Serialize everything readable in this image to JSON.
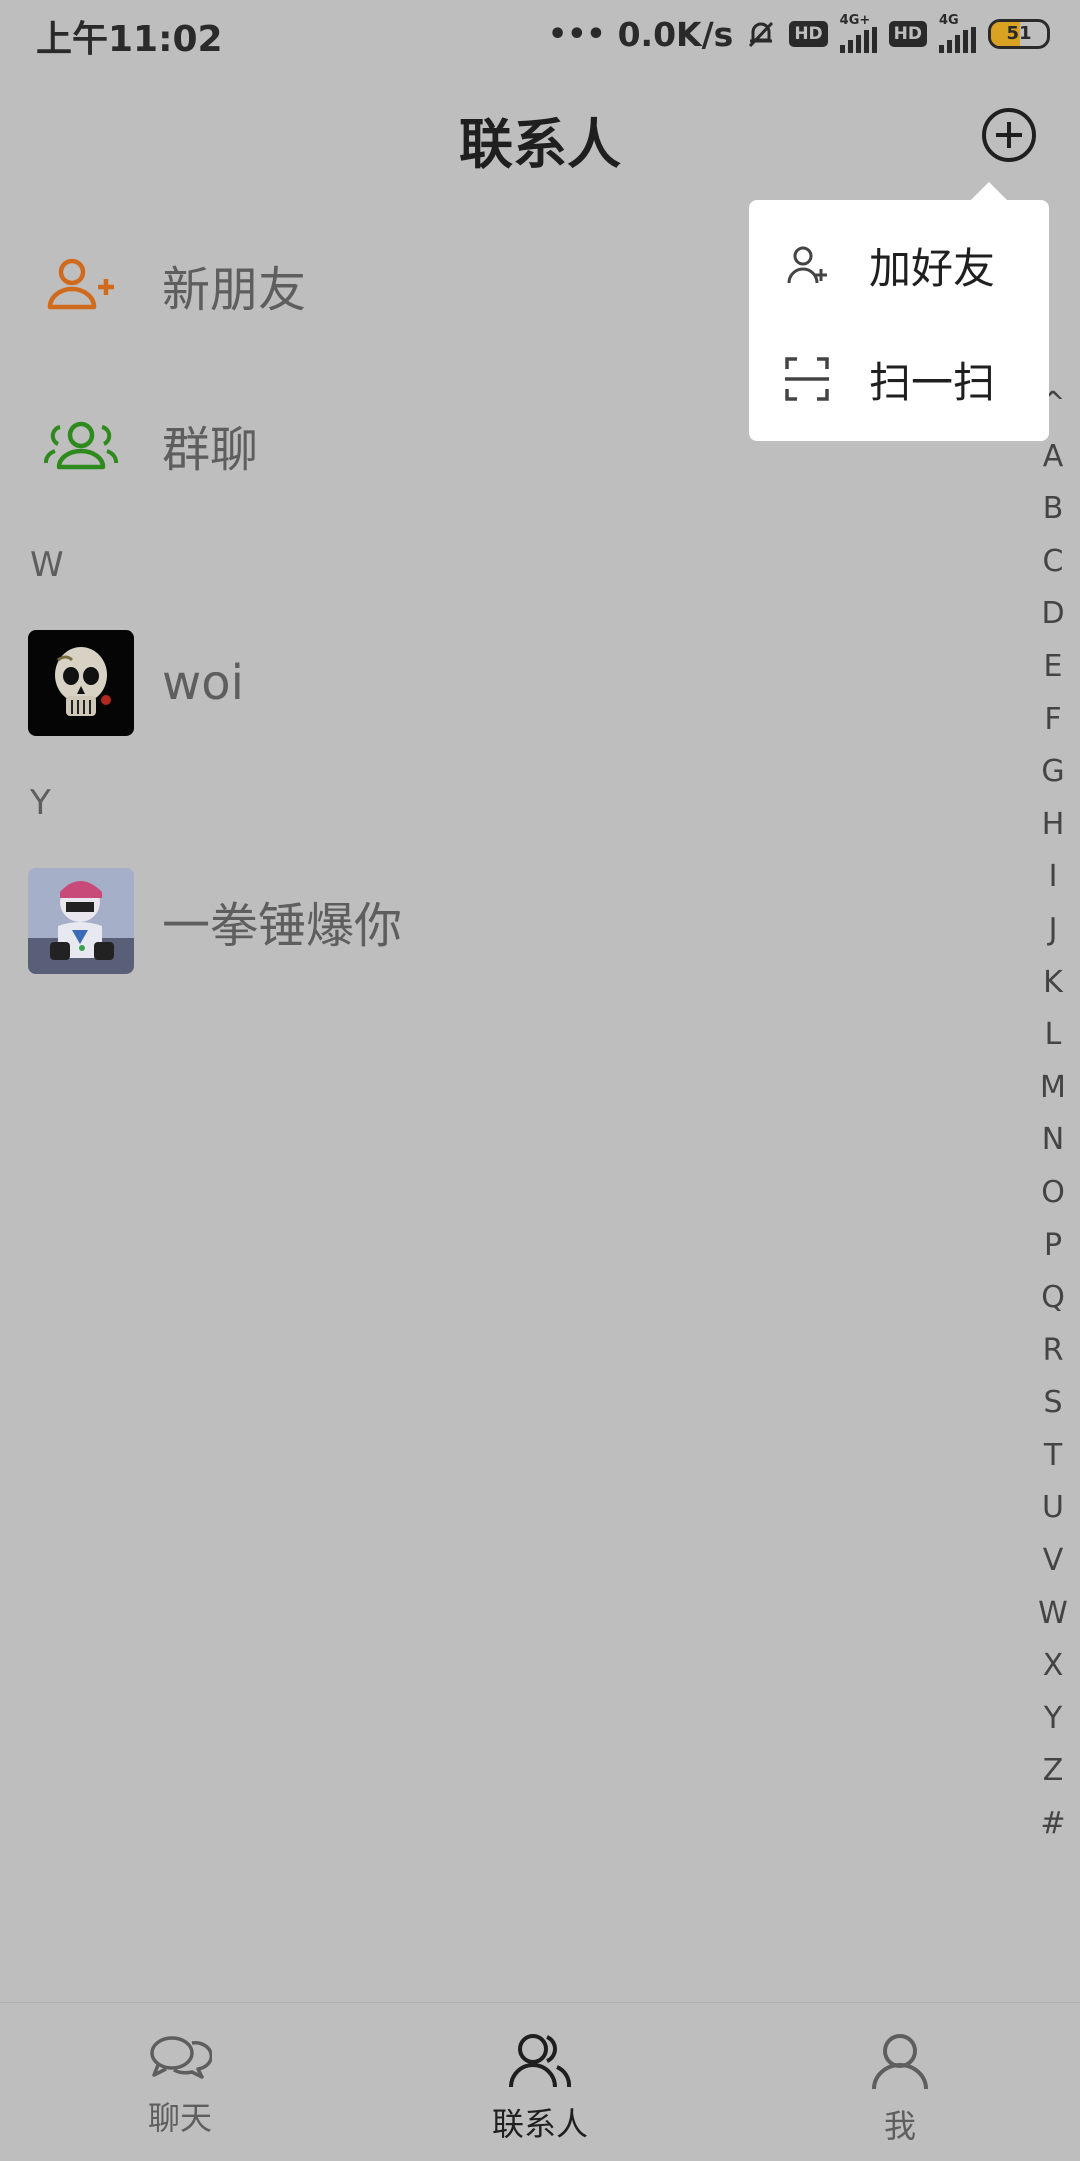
{
  "status_bar": {
    "time": "上午11:02",
    "network_speed": "0.0K/s",
    "hd_badge": "HD",
    "signal1_type": "4G+",
    "signal2_type": "4G",
    "battery_level": "51",
    "battery_fraction": 0.51,
    "battery_color": "#d9a321"
  },
  "header": {
    "title": "联系人",
    "add_icon": "circle-plus-icon"
  },
  "contacts": {
    "fixed": [
      {
        "label": "新朋友",
        "icon": "add-person-icon",
        "color": "#d06a1c"
      },
      {
        "label": "群聊",
        "icon": "group-icon",
        "color": "#2f8a1e"
      }
    ],
    "sections": [
      {
        "letter": "W",
        "items": [
          {
            "name": "woi"
          }
        ]
      },
      {
        "letter": "Y",
        "items": [
          {
            "name": "一拳锤爆你"
          }
        ]
      }
    ]
  },
  "popup_menu": {
    "items": [
      {
        "label": "加好友",
        "icon": "add-friend-icon"
      },
      {
        "label": "扫一扫",
        "icon": "scan-icon"
      }
    ]
  },
  "index_bar": {
    "letters": [
      "^",
      "A",
      "B",
      "C",
      "D",
      "E",
      "F",
      "G",
      "H",
      "I",
      "J",
      "K",
      "L",
      "M",
      "N",
      "O",
      "P",
      "Q",
      "R",
      "S",
      "T",
      "U",
      "V",
      "W",
      "X",
      "Y",
      "Z",
      "#"
    ]
  },
  "tab_bar": {
    "tabs": [
      {
        "label": "聊天",
        "icon": "chat-icon"
      },
      {
        "label": "联系人",
        "icon": "contacts-icon",
        "active": true
      },
      {
        "label": "我",
        "icon": "me-icon"
      }
    ]
  }
}
